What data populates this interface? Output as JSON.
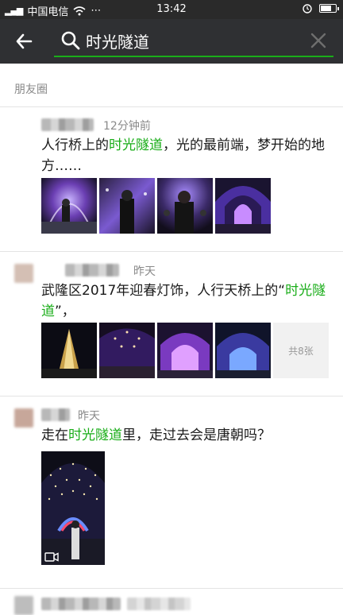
{
  "status": {
    "carrier": "中国电信",
    "time": "13:42",
    "battery_level": 0.7
  },
  "search": {
    "query": "时光隧道",
    "highlight": "时光隧道"
  },
  "section": {
    "label": "朋友圈"
  },
  "posts": [
    {
      "time": "12分钟前",
      "text_before": "人行桥上的",
      "text_highlight": "时光隧道",
      "text_after": "，光的最前端，梦开始的地方……",
      "images": [
        "tunnel-crowd",
        "tunnel-person",
        "tunnel-selfie",
        "tunnel-arch"
      ]
    },
    {
      "time": "昨天",
      "text_before": "武隆区2017年迎春灯饰，人行天桥上的“",
      "text_highlight": "时光隧道",
      "text_after": "”，",
      "images": [
        "tower-night",
        "tunnel-lights",
        "tunnel-walk",
        "tunnel-blue"
      ],
      "more_label": "共8张"
    },
    {
      "time": "昨天",
      "text_before": "走在",
      "text_highlight": "时光隧道",
      "text_after": "里，走过去会是唐朝吗？",
      "video": true
    }
  ],
  "icons": {
    "back": "back-arrow-icon",
    "search": "search-icon",
    "clear": "close-icon",
    "video": "video-icon"
  },
  "colors": {
    "accent": "#1aad19",
    "bar": "#2f3033"
  }
}
